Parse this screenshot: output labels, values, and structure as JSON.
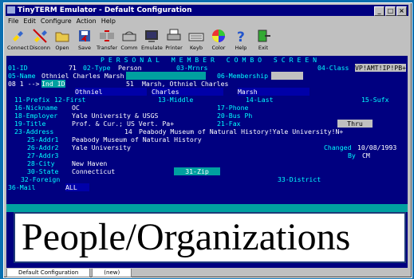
{
  "window": {
    "title": "TinyTERM Emulator - Default Configuration",
    "buttons": [
      "_",
      "□",
      "×"
    ]
  },
  "menu": [
    "File",
    "Edit",
    "Configure",
    "Action",
    "Help"
  ],
  "toolbar": [
    "Connect",
    "Disconn",
    "Open",
    "Save",
    "Transfer",
    "Comm",
    "Emulate",
    "Printer",
    "Keyb",
    "Color",
    "Help",
    "Exit"
  ],
  "screen": {
    "heading": "P E R S O N A L   M E M B E R   C O M B O   S C R E E N",
    "id_label": "01-ID",
    "id_value": "71",
    "type_label": "02-Type",
    "type_value": "Person",
    "mrnrs_label": "03-Mrnrs",
    "class_label": "04-Class",
    "class_value": "VP!AMT!IP!PB+",
    "name_label": "05-Name",
    "name_value": "Othniel Charles Marsh",
    "membership_label": "06-Membership",
    "row3_prefix": "08 1 -->",
    "ind_id_label": "Ind ID",
    "ind_id_value": "51",
    "ind_name": "Marsh, Othniel Charles",
    "first_col": "Othniel",
    "middle_col": "Charles",
    "last_col": "Marsh",
    "prefix_label": "11-Prefix",
    "first_label": "12-First",
    "middle_label": "13-Middle",
    "last_label": "14-Last",
    "sufx_label": "15-Sufx",
    "nickname_label": "16-Nickname",
    "nickname_value": "OC",
    "phone_label": "17-Phone",
    "employer_label": "18-Employer",
    "employer_value": "Yale University & USGS",
    "busph_label": "20-Bus Ph",
    "title_label": "19-Title",
    "title_value": "Prof. & Cur.; US Vert. Pa+",
    "fax_label": "21-Fax",
    "thru_value": "Thru",
    "address_label": "23-Address",
    "address_num": "14",
    "address_value": "Peabody Museum of Natural History!Yale University!N+",
    "addr1_label": "25-Addr1",
    "addr1_value": "Peabody Museum of Natural History",
    "addr2_label": "26-Addr2",
    "addr2_value": "Yale University",
    "changed_label": "Changed",
    "changed_value": "10/08/1993",
    "addr3_label": "27-Addr3",
    "by_label": "By",
    "by_value": "CM",
    "city_label": "28-City",
    "city_value": "New Haven",
    "state_label": "30-State",
    "state_value": "Connecticut",
    "zip_label": "31-Zip",
    "foreign_label": "32-Foreign",
    "district_label": "33-District",
    "mail_label": "36-Mail",
    "mail_value": "ALL"
  },
  "banner": "People/Organizations",
  "tabs": [
    "Default Configuration",
    "(new)"
  ]
}
